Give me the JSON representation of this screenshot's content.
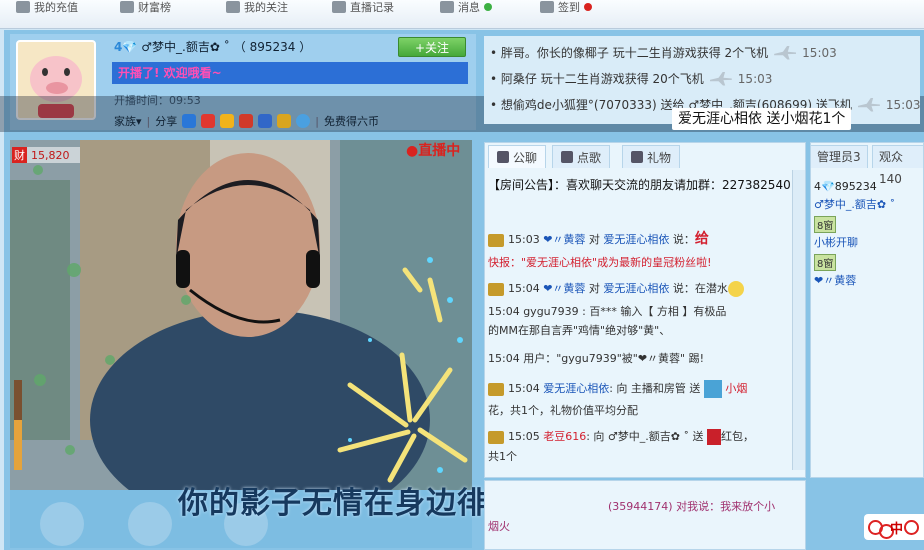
{
  "topbar": {
    "items": [
      "我的充值",
      "财富榜",
      "我的关注",
      "直播记录",
      "消息",
      "签到"
    ]
  },
  "anchor": {
    "name": "♂梦中_.额吉✿ ˚",
    "room_id": "（ 895234 ）",
    "follow_label": "+关注",
    "announcement": "开播了! 欢迎哦看~",
    "start_time": "开播时间：09:53",
    "family_label": "家族▾",
    "share_label": "分享",
    "free_coins": "免费得六币",
    "wealth_tag": "财",
    "wealth_value": "15,820",
    "live_label": "●直播中"
  },
  "subtitle": "你的影子无情在身边徘徊",
  "gift_feed": [
    {
      "text": "• 胖哥。你长的像椰子 玩十二生肖游戏获得 2个飞机",
      "time": "15:03"
    },
    {
      "text": "• 阿桑仔 玩十二生肖游戏获得 20个飞机",
      "time": "15:03"
    },
    {
      "text": "• 想偷鸡de小狐狸°(7070333) 送给 ♂梦中_.额吉(608699) 送飞机",
      "time": "15:03"
    }
  ],
  "float_gift": "爱无涯心相依  送小烟花1个",
  "chat": {
    "tabs": [
      "公聊",
      "点歌",
      "礼物"
    ],
    "messages": {
      "notice": "【房间公告】：喜欢聊天交流的朋友请加群：227382540",
      "m1_time": "15:03",
      "m1_from": "❤〃黄蓉",
      "m1_mid": "对",
      "m1_to": "爱无涯心相依",
      "m1_tail": "说：",
      "m1_emote": "给",
      "m2": "快报：\"爱无涯心相依\"成为最新的皇冠粉丝啦!",
      "m3_time": "15:04",
      "m3_from": "❤〃黄蓉",
      "m3_mid": "对",
      "m3_to": "爱无涯心相依",
      "m3_tail": "说：在潜水",
      "m4_a": "15:04  gygu7939 : 百***    输入【 方相 】有极品",
      "m4_b": "的MM在那自言弄\"鸡情\"绝对够\"黄\"、",
      "m5": "15:04 用户：\"gygu7939\"被\"❤〃黄蓉\" 踢!",
      "m6_time": "15:04",
      "m6_from": "爱无涯心相依",
      "m6_mid": ": 向 主播和房管 送",
      "m6_gift": "小烟",
      "m6_b": "花，共1个，礼物价值平均分配",
      "m7_time": "15:05",
      "m7_from": "老豆616",
      "m7_mid": ": 向 ♂梦中_.额吉✿ ˚ 送",
      "m7_gift": "红包，",
      "m7_b": "共1个",
      "m8_a": "(35944174) 对我说：我来放个小",
      "m8_b": "烟火"
    }
  },
  "admin_panel": {
    "tabs": [
      "管理员3",
      "观众140"
    ],
    "users": {
      "u1_id": "4💎895234",
      "u1_name": "♂梦中_.额吉✿ ˚",
      "u2_badge": "8窗",
      "u2_name": "小彬开聊",
      "u3_badge": "8窗",
      "u3_name": "❤〃黄蓉"
    }
  },
  "olympic_text": "中"
}
